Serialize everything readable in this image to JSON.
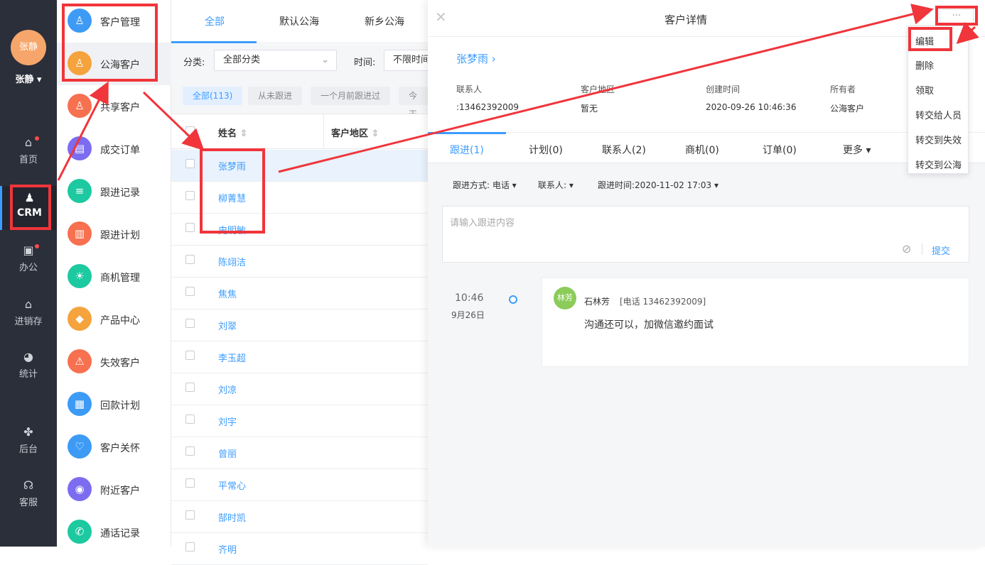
{
  "user": {
    "avatar_text": "张静",
    "name": "张静"
  },
  "rail": [
    {
      "label": "首页",
      "icon": "home-icon"
    },
    {
      "label": "CRM",
      "icon": "crm-icon"
    },
    {
      "label": "办公",
      "icon": "office-icon"
    },
    {
      "label": "进销存",
      "icon": "inventory-icon"
    },
    {
      "label": "统计",
      "icon": "pie-chart-icon"
    },
    {
      "label": "后台",
      "icon": "grid-icon"
    },
    {
      "label": "客服",
      "icon": "headset-icon"
    }
  ],
  "menu": [
    {
      "label": "客户管理",
      "color": "#3d9bf5"
    },
    {
      "label": "公海客户",
      "color": "#f5a33d"
    },
    {
      "label": "共享客户",
      "color": "#f7704f"
    },
    {
      "label": "成交订单",
      "color": "#7b6cf0"
    },
    {
      "label": "跟进记录",
      "color": "#1dc9a0"
    },
    {
      "label": "跟进计划",
      "color": "#f7704f"
    },
    {
      "label": "商机管理",
      "color": "#1dc9a0"
    },
    {
      "label": "产品中心",
      "color": "#f5a33d"
    },
    {
      "label": "失效客户",
      "color": "#f7704f"
    },
    {
      "label": "回款计划",
      "color": "#3d9bf5"
    },
    {
      "label": "客户关怀",
      "color": "#3d9bf5"
    },
    {
      "label": "附近客户",
      "color": "#7b6cf0"
    },
    {
      "label": "通话记录",
      "color": "#1dc9a0"
    }
  ],
  "list": {
    "tabs": [
      "全部",
      "默认公海",
      "新乡公海"
    ],
    "filter_category_label": "分类:",
    "filter_category_value": "全部分类",
    "filter_time_label": "时间:",
    "filter_time_value": "不限时间",
    "chips": [
      "全部(113)",
      "从未跟进",
      "一个月前跟进过",
      "今天"
    ],
    "col_name": "姓名",
    "col_region": "客户地区",
    "rows": [
      "张梦雨",
      "柳菁慧",
      "史明敏",
      "陈翊洁",
      "焦焦",
      "刘翠",
      "李玉超",
      "刘凉",
      "刘宇",
      "曾丽",
      "平常心",
      "郜时凯",
      "齐明"
    ]
  },
  "detail": {
    "title": "客户详情",
    "more": "···",
    "customer_name": "张梦雨 ›",
    "info": [
      {
        "label": "联系人",
        "value": ":13462392009"
      },
      {
        "label": "客户地区",
        "value": "暂无"
      },
      {
        "label": "创建时间",
        "value": "2020-09-26 10:46:36"
      },
      {
        "label": "所有者",
        "value": "公海客户"
      }
    ],
    "tabs": [
      "跟进(1)",
      "计划(0)",
      "联系人(2)",
      "商机(0)",
      "订单(0)",
      "更多 ▾"
    ],
    "fu_method": "跟进方式: 电话 ▾",
    "fu_contact": "联系人: ▾",
    "fu_time": "跟进时间:2020-11-02 17:03 ▾",
    "input_placeholder": "请输入跟进内容",
    "submit": "提交",
    "timeline": {
      "time": "10:46",
      "date": "9月26日",
      "avatar": "林芳",
      "author": "石林芳",
      "phone": "[电话 13462392009]",
      "content": "沟通还可以，加微信邀约面试"
    }
  },
  "dropdown": [
    "编辑",
    "删除",
    "领取",
    "转交给人员",
    "转交到失效",
    "转交到公海"
  ]
}
